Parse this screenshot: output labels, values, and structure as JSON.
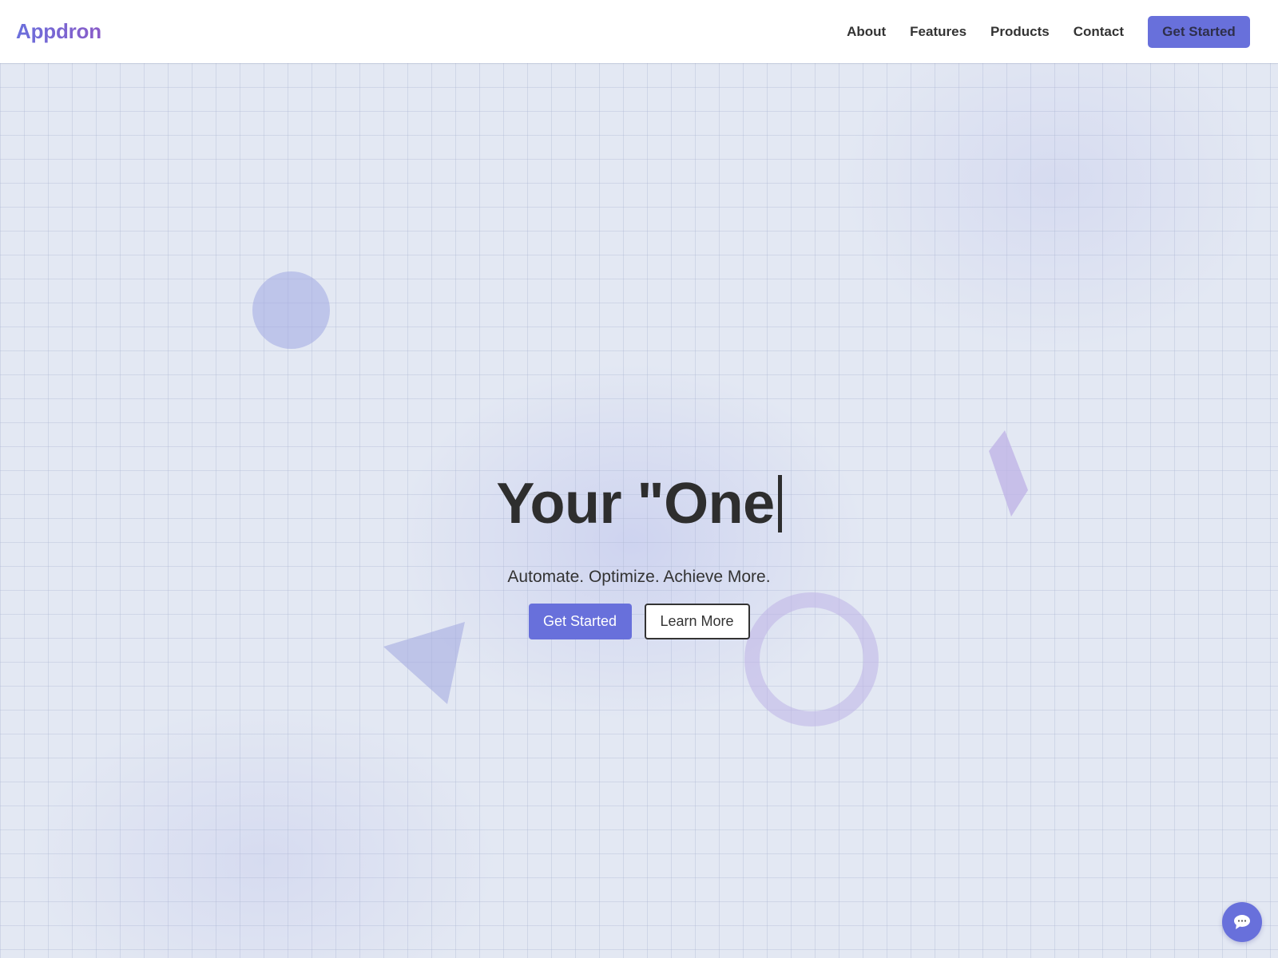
{
  "navbar": {
    "logo": "Appdron",
    "links": [
      {
        "label": "About"
      },
      {
        "label": "Features"
      },
      {
        "label": "Products"
      },
      {
        "label": "Contact"
      }
    ],
    "cta_label": "Get Started"
  },
  "hero": {
    "title": "Your \"One",
    "subtitle": "Automate. Optimize. Achieve More.",
    "primary_button": "Get Started",
    "secondary_button": "Learn More"
  },
  "decorations": {
    "shapes": [
      "circle",
      "ring",
      "triangle",
      "diamond"
    ],
    "background": "grid-pattern"
  },
  "chat_widget": {
    "icon": "chat-bubble-icon"
  },
  "colors": {
    "accent": "#6870db",
    "logo_gradient_start": "#6a6fdc",
    "logo_gradient_end": "#8a5cc8",
    "text": "#2e2e2e",
    "background": "#e3e8f3"
  }
}
